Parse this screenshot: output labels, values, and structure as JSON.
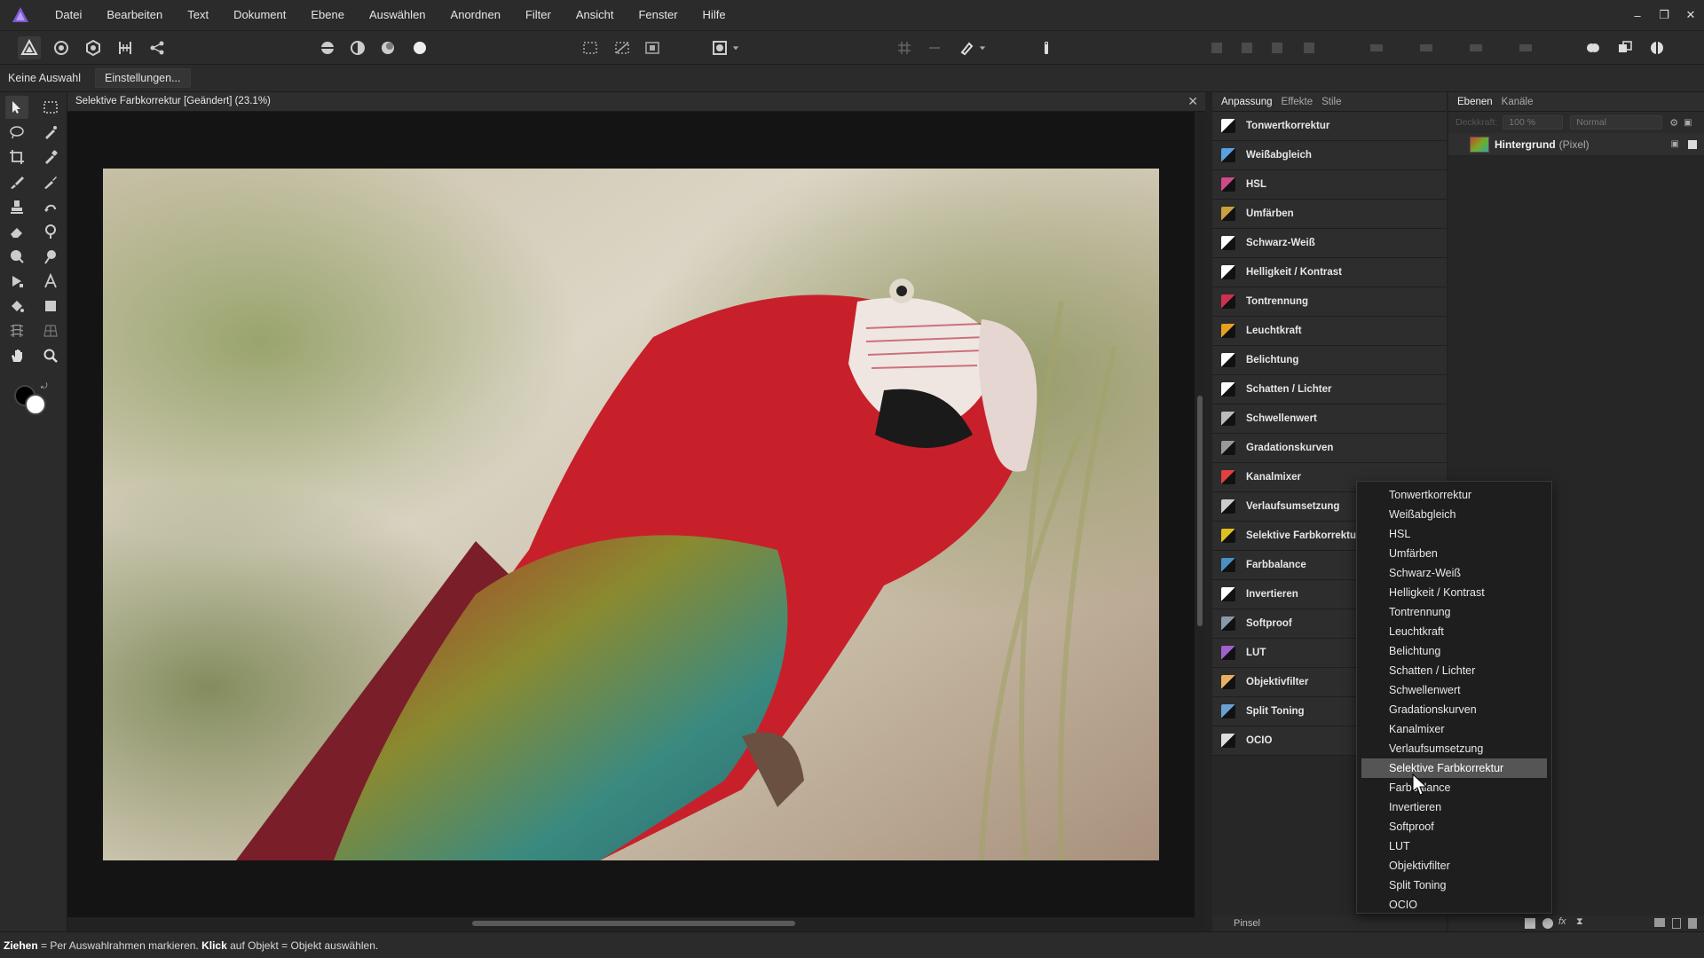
{
  "menubar": {
    "items": [
      "Datei",
      "Bearbeiten",
      "Text",
      "Dokument",
      "Ebene",
      "Auswählen",
      "Anordnen",
      "Filter",
      "Ansicht",
      "Fenster",
      "Hilfe"
    ],
    "window_controls": [
      "–",
      "❐",
      "✕"
    ]
  },
  "contextbar": {
    "selection_label": "Keine Auswahl",
    "settings_button": "Einstellungen..."
  },
  "document": {
    "title": "Selektive Farbkorrektur [Geändert] (23.1%)",
    "close_glyph": "✕"
  },
  "adjustment_panel": {
    "tabs": [
      "Anpassung",
      "Effekte",
      "Stile"
    ],
    "items": [
      {
        "label": "Tonwertkorrektur",
        "color": "#ffffff"
      },
      {
        "label": "Weißabgleich",
        "color": "#5aa0e0"
      },
      {
        "label": "HSL",
        "color": "#d04a8a"
      },
      {
        "label": "Umfärben",
        "color": "#c8a040"
      },
      {
        "label": "Schwarz-Weiß",
        "color": "#ffffff"
      },
      {
        "label": "Helligkeit / Kontrast",
        "color": "#ffffff"
      },
      {
        "label": "Tontrennung",
        "color": "#d03050"
      },
      {
        "label": "Leuchtkraft",
        "color": "#e8a020"
      },
      {
        "label": "Belichtung",
        "color": "#ffffff"
      },
      {
        "label": "Schatten / Lichter",
        "color": "#ffffff"
      },
      {
        "label": "Schwellenwert",
        "color": "#bbbbbb"
      },
      {
        "label": "Gradationskurven",
        "color": "#999999"
      },
      {
        "label": "Kanalmixer",
        "color": "#e04040"
      },
      {
        "label": "Verlaufsumsetzung",
        "color": "#cccccc"
      },
      {
        "label": "Selektive Farbkorrektur",
        "color": "#e0c020"
      },
      {
        "label": "Farbbalance",
        "color": "#4a90c0"
      },
      {
        "label": "Invertieren",
        "color": "#ffffff"
      },
      {
        "label": "Softproof",
        "color": "#8899aa"
      },
      {
        "label": "LUT",
        "color": "#a060d0"
      },
      {
        "label": "Objektivfilter",
        "color": "#e8b060"
      },
      {
        "label": "Split Toning",
        "color": "#6aa0d0"
      },
      {
        "label": "OCIO",
        "color": "#dddddd"
      }
    ],
    "footer_label": "Pinsel"
  },
  "layers_panel": {
    "tabs": [
      "Ebenen",
      "Kanäle"
    ],
    "opacity_label": "Deckkraft:",
    "opacity_value": "100 %",
    "blend_mode": "Normal",
    "layer": {
      "name": "Hintergrund",
      "type": "(Pixel)"
    }
  },
  "dropdown": {
    "items": [
      "Tonwertkorrektur",
      "Weißabgleich",
      "HSL",
      "Umfärben",
      "Schwarz-Weiß",
      "Helligkeit / Kontrast",
      "Tontrennung",
      "Leuchtkraft",
      "Belichtung",
      "Schatten / Lichter",
      "Schwellenwert",
      "Gradationskurven",
      "Kanalmixer",
      "Verlaufsumsetzung",
      "Selektive Farbkorrektur",
      "Farbbalance",
      "Invertieren",
      "Softproof",
      "LUT",
      "Objektivfilter",
      "Split Toning",
      "OCIO"
    ],
    "selected": "Selektive Farbkorrektur"
  },
  "statusbar": {
    "key1": "Ziehen",
    "text1": " = Per Auswahlrahmen markieren. ",
    "key2": "Klick",
    "text2": " auf Objekt = Objekt auswählen."
  },
  "colors": {
    "accent": "#7d5ad6",
    "panel": "#2d2d2d",
    "canvas": "#141414"
  }
}
